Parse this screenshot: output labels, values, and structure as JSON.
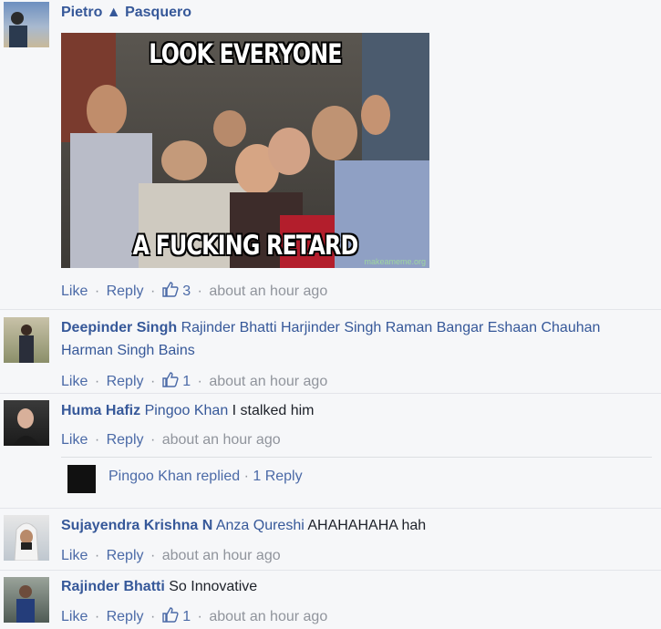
{
  "actions": {
    "like": "Like",
    "reply": "Reply",
    "sep": "·"
  },
  "comments": [
    {
      "author": "Pietro ▲ Pasquero",
      "body": "",
      "likes": "3",
      "time": "about an hour ago",
      "meme": {
        "top_text": "LOOK EVERYONE",
        "bottom_text": "A FUCKING RETARD",
        "watermark": "makeameme.org"
      }
    },
    {
      "author": "Deepinder Singh",
      "mentions": "Rajinder Bhatti Harjinder Singh Raman Bangar Eshaan Chauhan Harman Singh Bains",
      "likes": "1",
      "time": "about an hour ago"
    },
    {
      "author": "Huma Hafiz",
      "mentions": "Pingoo Khan",
      "body": " I stalked him",
      "time": "about an hour ago",
      "replies": {
        "label": "Pingoo Khan replied",
        "count": "1 Reply"
      }
    },
    {
      "author": "Sujayendra Krishna N",
      "mentions": "Anza Qureshi",
      "body": " AHAHAHAHA hah",
      "time": "about an hour ago"
    },
    {
      "author": "Rajinder Bhatti",
      "body": " So Innovative",
      "likes": "1",
      "time": "about an hour ago"
    }
  ],
  "colors": {
    "link": "#365899",
    "meta": "#90949c",
    "background": "#f6f7f9"
  },
  "icons": {
    "like": "thumbs-up-icon"
  }
}
